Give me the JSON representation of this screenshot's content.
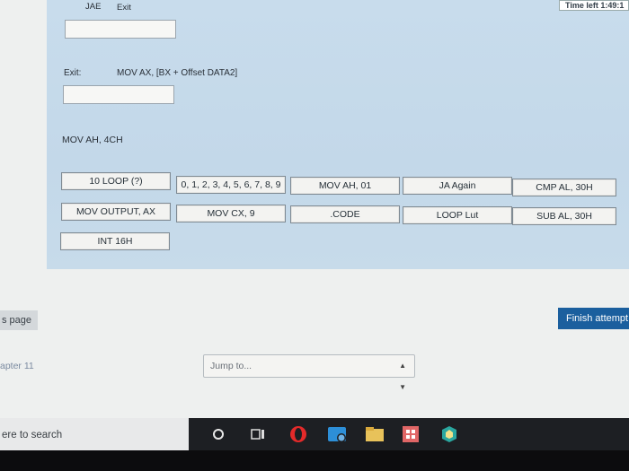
{
  "top_links": {
    "left": "JAE",
    "right": "Exit"
  },
  "timer": "Time left 1:49:1",
  "question": {
    "exit_label": "Exit:",
    "instruction_line": "MOV AX, [BX + Offset DATA2]",
    "static_line": "MOV AH, 4CH",
    "choices": [
      "10 LOOP (?)",
      "0, 1, 2, 3, 4, 5, 6, 7, 8, 9",
      "MOV AH, 01",
      "JA Again",
      "CMP AL, 30H",
      "MOV OUTPUT, AX",
      "MOV CX, 9",
      ".CODE",
      "LOOP Lut",
      "SUB AL, 30H",
      "INT 16H"
    ]
  },
  "nav": {
    "previous_label": "s page",
    "finish_label": "Finish attempt",
    "chapter_label": "apter 11",
    "jump_placeholder": "Jump to..."
  },
  "taskbar": {
    "search_text": "ere to search",
    "icons": [
      "cortana-icon",
      "task-view-icon",
      "opera-icon",
      "teamviewer-icon",
      "file-explorer-icon",
      "store-icon",
      "browser-icon"
    ]
  },
  "colors": {
    "panel": "#c8dcec",
    "finish_button": "#1b5f9e",
    "taskbar": "#1d1f23"
  }
}
